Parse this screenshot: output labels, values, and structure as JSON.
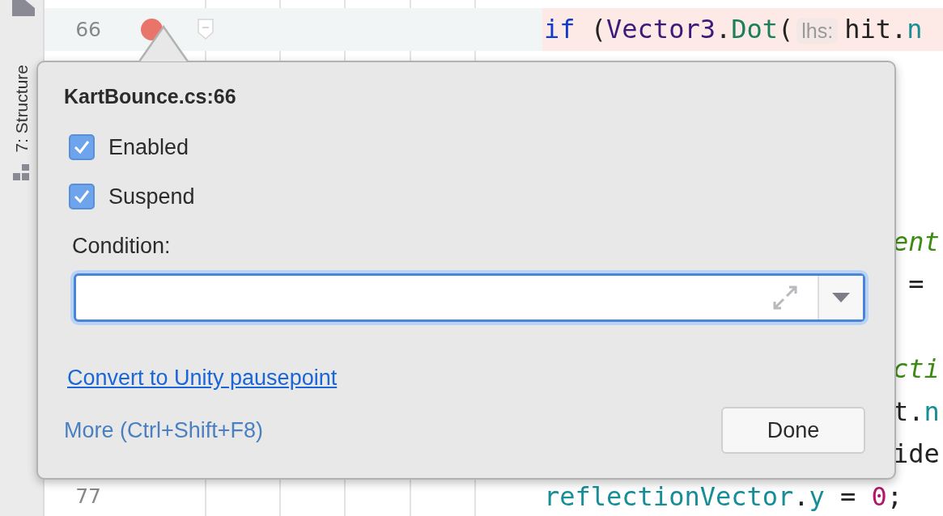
{
  "sidebar": {
    "tool_window": "7: Structure"
  },
  "editor": {
    "lines": [
      {
        "kind": "full",
        "number": "66",
        "breakpoint": true,
        "highlighted": true,
        "tokens": [
          {
            "kind": "keyword",
            "text": "if"
          },
          {
            "kind": "plain",
            "text": " ("
          },
          {
            "kind": "type",
            "text": "Vector3"
          },
          {
            "kind": "plain",
            "text": "."
          },
          {
            "kind": "method",
            "text": "Dot"
          },
          {
            "kind": "plain",
            "text": "("
          },
          {
            "kind": "hint",
            "text": "lhs:"
          },
          {
            "kind": "plain",
            "text": "hit."
          },
          {
            "kind": "field",
            "text": "n"
          }
        ]
      },
      {
        "kind": "blank"
      },
      {
        "kind": "blank"
      },
      {
        "kind": "blank"
      },
      {
        "kind": "blank"
      },
      {
        "kind": "clipped",
        "tokens": [
          {
            "kind": "comment",
            "text": "ent"
          }
        ]
      },
      {
        "kind": "clipped",
        "tokens": [
          {
            "kind": "plain",
            "text": " ="
          }
        ]
      },
      {
        "kind": "blank"
      },
      {
        "kind": "clipped",
        "tokens": [
          {
            "kind": "comment",
            "text": "cti"
          }
        ]
      },
      {
        "kind": "clipped",
        "tokens": [
          {
            "kind": "plain",
            "text": "t."
          },
          {
            "kind": "field",
            "text": "n"
          }
        ]
      },
      {
        "kind": "clipped",
        "tokens": [
          {
            "kind": "plain",
            "text": "ide"
          }
        ]
      },
      {
        "kind": "full",
        "number": "77",
        "breakpoint": false,
        "highlighted": false,
        "tokens": [
          {
            "kind": "field",
            "text": "reflectionVector"
          },
          {
            "kind": "plain",
            "text": "."
          },
          {
            "kind": "field",
            "text": "y"
          },
          {
            "kind": "plain",
            "text": " = "
          },
          {
            "kind": "number",
            "text": "0"
          },
          {
            "kind": "plain",
            "text": ";"
          }
        ]
      }
    ]
  },
  "popup": {
    "title": "KartBounce.cs:66",
    "options": [
      {
        "label": "Enabled",
        "checked": true
      },
      {
        "label": "Suspend",
        "checked": true
      }
    ],
    "condition_label": "Condition:",
    "link": "Convert to Unity pausepoint",
    "more": "More (Ctrl+Shift+F8)",
    "button": "Done"
  }
}
